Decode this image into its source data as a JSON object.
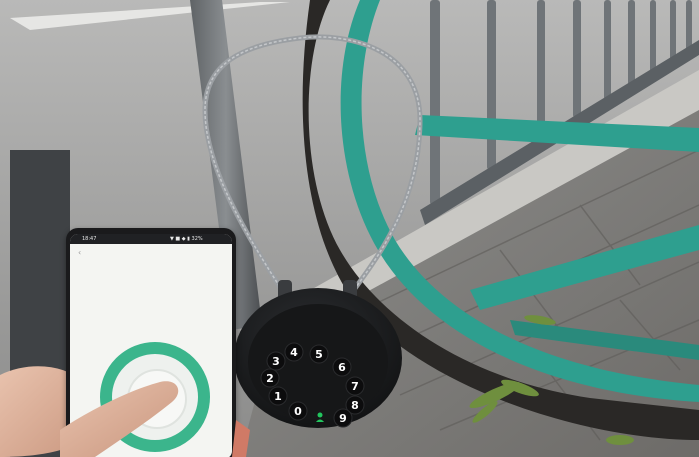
{
  "scene": {
    "phone": {
      "status_time": "18:47",
      "status_icons": "▼ ■ ◆ ▮ 32%",
      "app_ring_color": "#3bb58c",
      "screen_bg": "#f4f5f2"
    },
    "lock": {
      "body_color": "#1c1d1f",
      "keypad_digits": [
        "4",
        "5",
        "6",
        "3",
        "7",
        "2",
        "8",
        "1",
        "9",
        "0"
      ],
      "indicator_icon": "person-indicator-icon",
      "indicator_color": "#22c55e"
    },
    "bike": {
      "frame_color": "#2e9f8f",
      "tire_color": "#2a2826"
    },
    "cable": {
      "color": "#9b9fa3"
    }
  }
}
